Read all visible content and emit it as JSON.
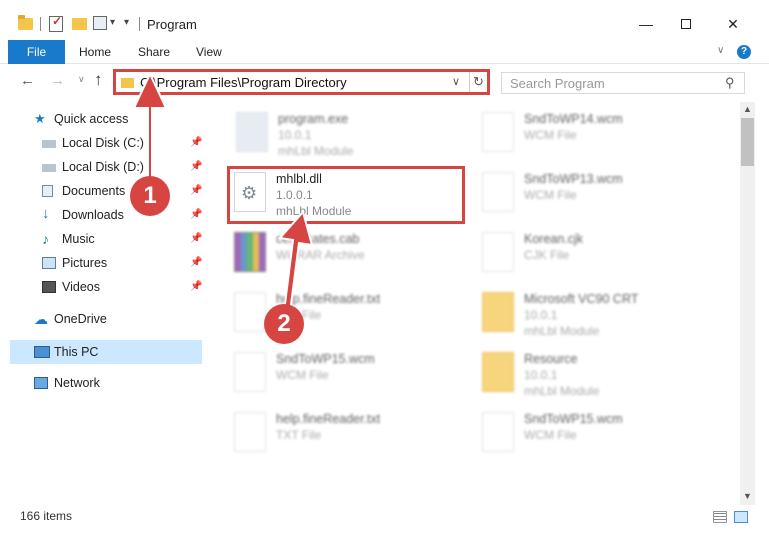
{
  "titlebar": {
    "title": "Program",
    "minimize": "—",
    "close": "✕"
  },
  "ribbon": {
    "tabs": [
      "File",
      "Home",
      "Share",
      "View"
    ]
  },
  "address": {
    "path": "C:\\Program Files\\Program Directory",
    "search_placeholder": "Search Program"
  },
  "nav": {
    "items": [
      {
        "label": "Quick access"
      },
      {
        "label": "Local Disk (C:)"
      },
      {
        "label": "Local Disk (D:)"
      },
      {
        "label": "Documents"
      },
      {
        "label": "Downloads"
      },
      {
        "label": "Music"
      },
      {
        "label": "Pictures"
      },
      {
        "label": "Videos"
      },
      {
        "label": "OneDrive"
      },
      {
        "label": "This PC"
      },
      {
        "label": "Network"
      }
    ]
  },
  "files": [
    {
      "name": "program.exe",
      "line2": "10.0.1",
      "line3": "mhLbl Module"
    },
    {
      "name": "mhlbl.dll",
      "line2": "1.0.0.1",
      "line3": "mhLbl Module"
    },
    {
      "name": "certificates.cab",
      "line2": "WinRAR Archive",
      "line3": ""
    },
    {
      "name": "help.fineReader.txt",
      "line2": "TXT File",
      "line3": ""
    },
    {
      "name": "SndToWP15.wcm",
      "line2": "WCM File",
      "line3": ""
    },
    {
      "name": "help.fineReader.txt",
      "line2": "TXT File",
      "line3": ""
    },
    {
      "name": "SndToWP14.wcm",
      "line2": "WCM File",
      "line3": ""
    },
    {
      "name": "SndToWP13.wcm",
      "line2": "WCM File",
      "line3": ""
    },
    {
      "name": "Korean.cjk",
      "line2": "CJK File",
      "line3": ""
    },
    {
      "name": "Microsoft VC90 CRT",
      "line2": "10.0.1",
      "line3": "mhLbl Module"
    },
    {
      "name": "Resource",
      "line2": "10.0.1",
      "line3": "mhLbl Module"
    },
    {
      "name": "SndToWP15.wcm",
      "line2": "WCM File",
      "line3": ""
    }
  ],
  "status": {
    "count": "166 items"
  },
  "annotations": {
    "badge1": "1",
    "badge2": "2",
    "color": "#d64541"
  }
}
